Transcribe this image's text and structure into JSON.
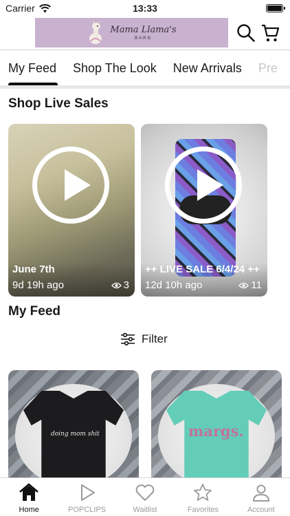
{
  "status_bar": {
    "carrier": "Carrier",
    "time": "13:33"
  },
  "header": {
    "logo_title": "Mama Llama's",
    "logo_subtitle": "BARN"
  },
  "tabs": [
    {
      "label": "My Feed",
      "active": true
    },
    {
      "label": "Shop The Look",
      "active": false
    },
    {
      "label": "New Arrivals",
      "active": false
    },
    {
      "label": "Pre",
      "active": false
    }
  ],
  "live_sales": {
    "title": "Shop Live Sales",
    "cards": [
      {
        "name": "June 7th",
        "age": "9d 19h ago",
        "views": "3"
      },
      {
        "name": "++ LIVE SALE 6/4/24 ++",
        "age": "12d 10h ago",
        "views": "11"
      }
    ]
  },
  "feed": {
    "title": "My Feed",
    "filter_label": "Filter",
    "products": [
      {
        "shirt_text": "doing mom shit",
        "color": "#1c1c1e"
      },
      {
        "shirt_text": "margs.",
        "color": "#63cdb8"
      }
    ]
  },
  "tab_bar": [
    {
      "label": "Home",
      "icon": "home-icon",
      "active": true
    },
    {
      "label": "POPCLIPS",
      "icon": "play-icon",
      "active": false
    },
    {
      "label": "Waitlist",
      "icon": "heart-icon",
      "active": false
    },
    {
      "label": "Favorites",
      "icon": "star-icon",
      "active": false
    },
    {
      "label": "Account",
      "icon": "person-icon",
      "active": false
    }
  ]
}
